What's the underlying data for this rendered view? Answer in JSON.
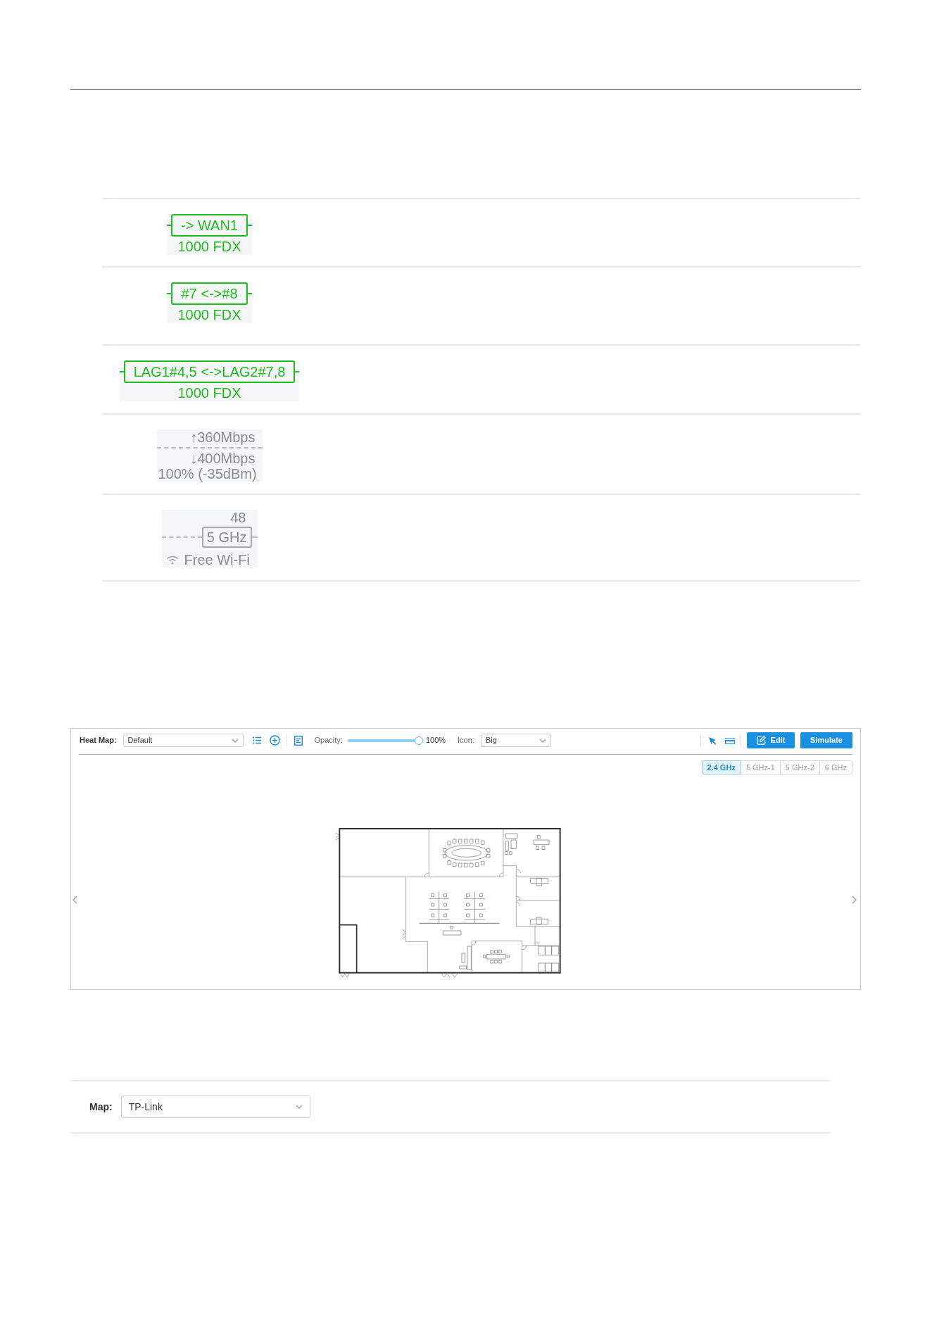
{
  "link_labels": [
    {
      "kind": "wired",
      "label": "-> WAN1",
      "speed": "1000 FDX"
    },
    {
      "kind": "wired",
      "label": "#7 <->#8",
      "speed": "1000 FDX"
    },
    {
      "kind": "wired",
      "label": "LAG1#4,5 <->LAG2#7,8",
      "speed": "1000 FDX"
    },
    {
      "kind": "mesh",
      "uplink": "↑360Mbps",
      "downlink": "↓400Mbps",
      "signal": "100% (-35dBm)"
    },
    {
      "kind": "wireless",
      "channel": "48",
      "band": "5 GHz",
      "ssid": "Free Wi-Fi"
    }
  ],
  "heat_map": {
    "label": "Heat Map:",
    "map_select": {
      "value": "Default"
    },
    "opacity": {
      "label": "Opacity:",
      "level": 1,
      "reading": "100%"
    },
    "icon_size": {
      "label": "Icon:",
      "value": "Big"
    },
    "buttons": [
      {
        "kind": "with_icon",
        "label": "Edit"
      },
      {
        "kind": "plain",
        "label": "Simulate"
      }
    ],
    "bands": [
      {
        "label": "2.4 GHz",
        "selected": true
      },
      {
        "label": "5 GHz-1",
        "selected": false
      },
      {
        "label": "5 GHz-2",
        "selected": false
      },
      {
        "label": "6 GHz",
        "selected": false
      }
    ]
  },
  "map_setting": {
    "label": "Map:",
    "value": "TP-Link"
  }
}
